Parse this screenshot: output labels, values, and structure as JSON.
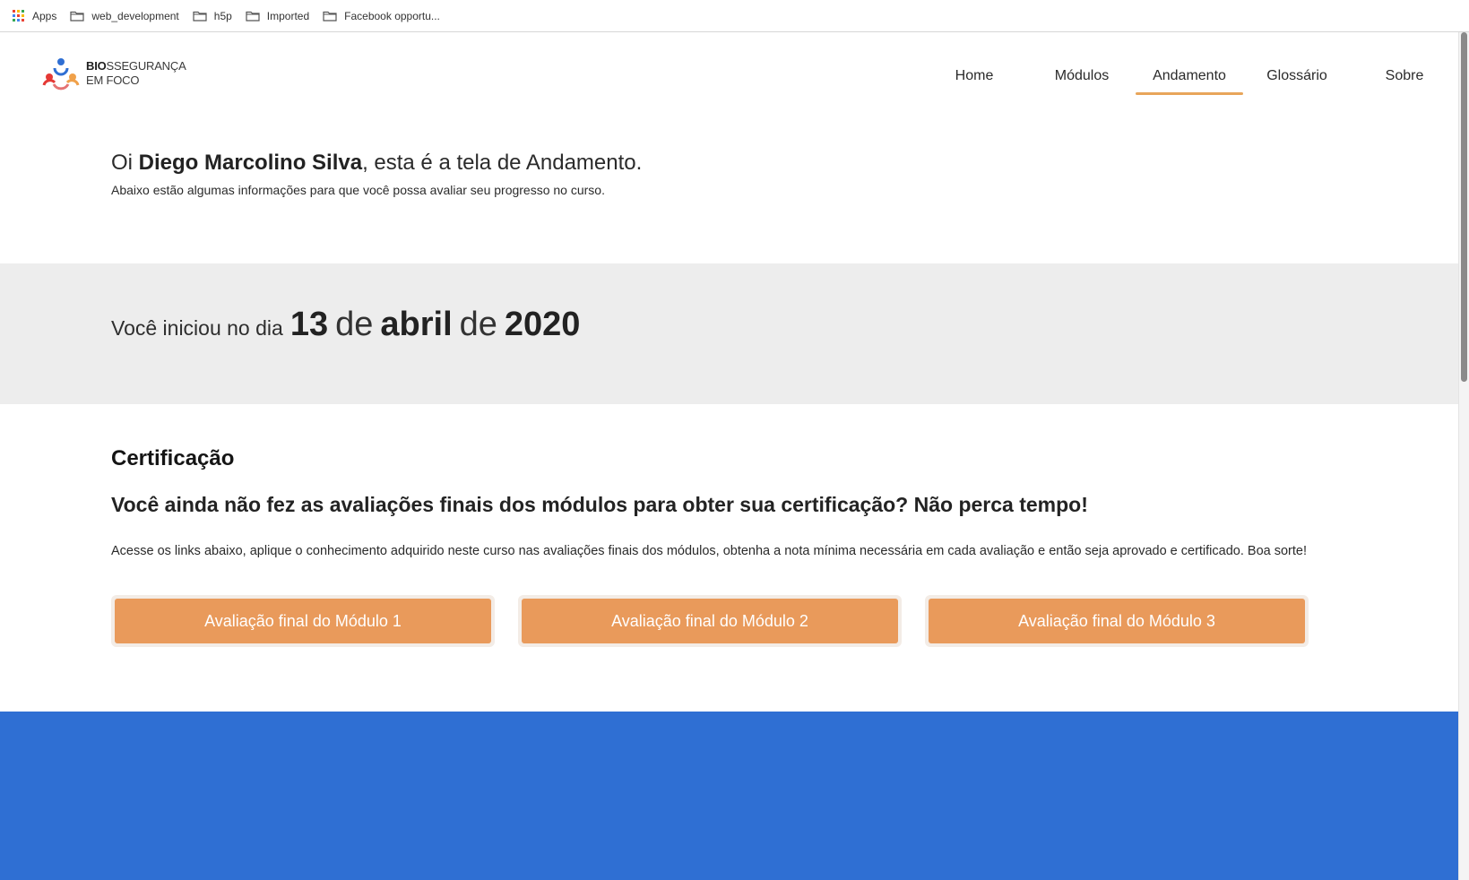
{
  "bookmarks": {
    "items": [
      {
        "label": "Apps",
        "icon": "apps-grid-icon"
      },
      {
        "label": "web_development",
        "icon": "folder-icon"
      },
      {
        "label": "h5p",
        "icon": "folder-icon"
      },
      {
        "label": "Imported",
        "icon": "folder-icon"
      },
      {
        "label": "Facebook opportu...",
        "icon": "folder-icon"
      }
    ]
  },
  "header": {
    "logo": {
      "bold": "BIO",
      "rest": "SSEGURANÇA",
      "line2": "EM FOCO"
    },
    "nav": [
      {
        "label": "Home",
        "active": false
      },
      {
        "label": "Módulos",
        "active": false
      },
      {
        "label": "Andamento",
        "active": true
      },
      {
        "label": "Glossário",
        "active": false
      },
      {
        "label": "Sobre",
        "active": false
      }
    ]
  },
  "greeting": {
    "prefix": "Oi ",
    "name": "Diego Marcolino Silva",
    "suffix": ", esta é a tela de Andamento.",
    "subtitle": "Abaixo estão algumas informações para que você possa avaliar seu progresso no curso."
  },
  "start": {
    "prefix": "Você iniciou no dia",
    "day": "13",
    "de1": "de",
    "month": "abril",
    "de2": "de",
    "year": "2020"
  },
  "certification": {
    "title": "Certificação",
    "headline": "Você ainda não fez as avaliações finais dos módulos para obter sua certificação? Não perca tempo!",
    "description": "Acesse os links abaixo, aplique o conhecimento adquirido neste curso nas avaliações finais dos módulos, obtenha a nota mínima necessária em cada avaliação e então seja aprovado e certificado. Boa sorte!",
    "buttons": [
      "Avaliação final do Módulo 1",
      "Avaliação final do Módulo 2",
      "Avaliação final do Módulo 3"
    ]
  },
  "colors": {
    "accent_orange": "#e99a5b",
    "nav_underline": "#e8a55a",
    "footer_blue": "#2f6fd3",
    "band_gray": "#ededed"
  }
}
